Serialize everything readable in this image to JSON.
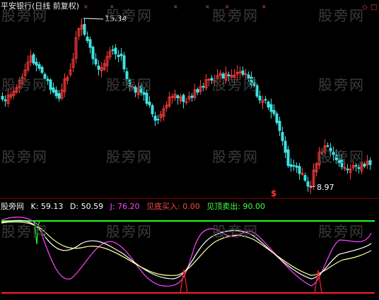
{
  "top_panel": {
    "title": "平安银行(日线 前复权)",
    "high_label": "15.34",
    "low_label": "8.97",
    "signal_marker": "$",
    "corner_icons": [
      "◇",
      "□"
    ]
  },
  "bottom_panel": {
    "name": "股旁网",
    "k": {
      "label": "K:",
      "value": "59.13",
      "color": "#ffffff"
    },
    "d": {
      "label": "D:",
      "value": "50.59",
      "color": "#ffff66"
    },
    "j": {
      "label": "J:",
      "value": "76.20",
      "color": "#ff44ff"
    },
    "buy": {
      "label": "见底买入:",
      "value": "0.00",
      "color": "#ff4444"
    },
    "sell": {
      "label": "见顶卖出:",
      "value": "90.00",
      "color": "#44ff44"
    }
  },
  "watermark": "股旁网",
  "colors": {
    "up": "#ff3b3b",
    "down": "#40e0e0",
    "background": "#000000"
  },
  "chart_data": {
    "type": "candlestick+kdj",
    "price_extremes": {
      "high": 15.34,
      "low": 8.97
    },
    "kdj_levels": {
      "top": 90.0,
      "bottom": 0.0
    },
    "series": [
      {
        "name": "K",
        "value": 59.13
      },
      {
        "name": "D",
        "value": 50.59
      },
      {
        "name": "J",
        "value": 76.2
      }
    ]
  }
}
